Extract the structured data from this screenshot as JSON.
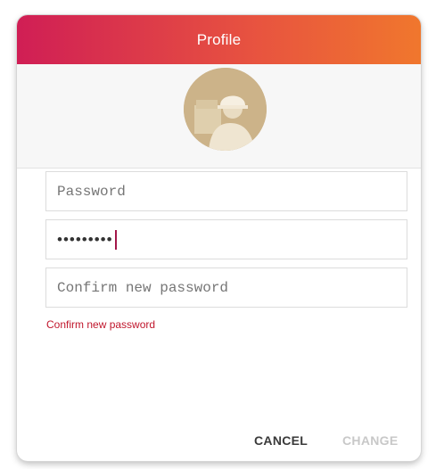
{
  "dialog": {
    "title": "Profile",
    "header_gradient": [
      "#d01e55",
      "#f0772d"
    ]
  },
  "avatar": {
    "icon": "worker-avatar-icon",
    "bg_color": "#ccb389"
  },
  "fields": {
    "password": {
      "placeholder": "Password",
      "value": ""
    },
    "new_password": {
      "masked_value": "•••••••••",
      "focused": true
    },
    "confirm_password": {
      "placeholder": "Confirm new password",
      "value": ""
    }
  },
  "error": {
    "text": "Confirm new password",
    "color": "#c0162c"
  },
  "actions": {
    "cancel_label": "CANCEL",
    "change_label": "CHANGE",
    "change_enabled": false
  }
}
